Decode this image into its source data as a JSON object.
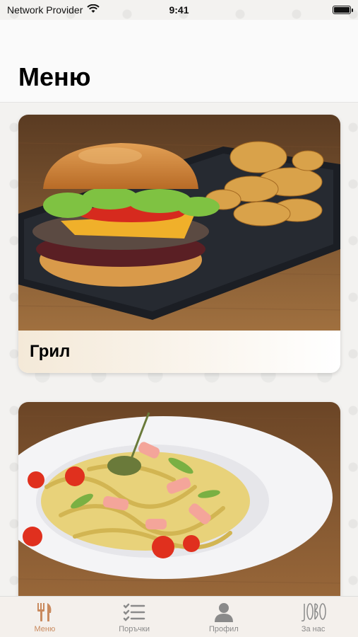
{
  "status_bar": {
    "carrier": "Network Provider",
    "time": "9:41"
  },
  "header": {
    "title": "Меню"
  },
  "menu_categories": [
    {
      "label": "Грил",
      "image": "burger-with-chips-photo"
    },
    {
      "label": "",
      "image": "pasta-with-salmon-photo"
    }
  ],
  "tab_bar": {
    "active": 0,
    "items": [
      {
        "label": "Меню",
        "icon": "fork-knife-icon"
      },
      {
        "label": "Поръчки",
        "icon": "checklist-icon"
      },
      {
        "label": "Профил",
        "icon": "person-icon"
      },
      {
        "label": "За нас",
        "icon": "jobo-logo-icon"
      }
    ]
  },
  "colors": {
    "accent": "#c98a5e",
    "inactive": "#8a8a8a",
    "background": "#f3f2f0"
  }
}
